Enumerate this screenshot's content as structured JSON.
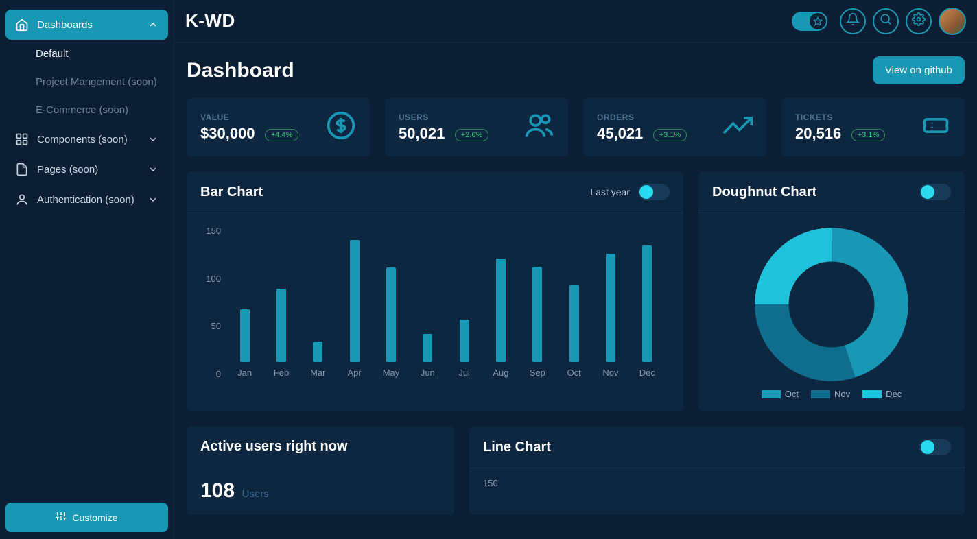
{
  "brand": "K-WD",
  "sidebar": {
    "items": [
      {
        "label": "Dashboards"
      },
      {
        "label": "Components (soon)"
      },
      {
        "label": "Pages (soon)"
      },
      {
        "label": "Authentication (soon)"
      }
    ],
    "dash_sub": [
      {
        "label": "Default"
      },
      {
        "label": "Project Mangement (soon)"
      },
      {
        "label": "E-Commerce (soon)"
      }
    ],
    "customize": "Customize"
  },
  "page": {
    "title": "Dashboard",
    "github_btn": "View on github"
  },
  "stats": [
    {
      "label": "Value",
      "value": "$30,000",
      "delta": "+4.4%"
    },
    {
      "label": "Users",
      "value": "50,021",
      "delta": "+2.6%"
    },
    {
      "label": "Orders",
      "value": "45,021",
      "delta": "+3.1%"
    },
    {
      "label": "Tickets",
      "value": "20,516",
      "delta": "+3.1%"
    }
  ],
  "barchart": {
    "title": "Bar Chart",
    "filter_label": "Last year"
  },
  "doughnut": {
    "title": "Doughnut Chart",
    "legend": [
      "Oct",
      "Nov",
      "Dec"
    ]
  },
  "active_users": {
    "title": "Active users right now",
    "count": "108",
    "unit": "Users"
  },
  "linechart": {
    "title": "Line Chart",
    "first_tick": "150"
  },
  "chart_data": [
    {
      "type": "bar",
      "title": "Bar Chart",
      "categories": [
        "Jan",
        "Feb",
        "Mar",
        "Apr",
        "May",
        "Jun",
        "Jul",
        "Aug",
        "Sep",
        "Oct",
        "Nov",
        "Dec"
      ],
      "values": [
        52,
        72,
        20,
        120,
        93,
        28,
        42,
        102,
        94,
        76,
        107,
        115
      ],
      "ylim": [
        0,
        150
      ],
      "yticks": [
        0,
        50,
        100,
        150
      ],
      "xlabel": "",
      "ylabel": ""
    },
    {
      "type": "pie",
      "title": "Doughnut Chart",
      "categories": [
        "Oct",
        "Nov",
        "Dec"
      ],
      "values": [
        45,
        30,
        25
      ],
      "colors": [
        "#1998b5",
        "#0f6e8e",
        "#20c1da"
      ]
    },
    {
      "type": "line",
      "title": "Line Chart",
      "ylim": [
        0,
        150
      ],
      "yticks": [
        150
      ]
    }
  ]
}
